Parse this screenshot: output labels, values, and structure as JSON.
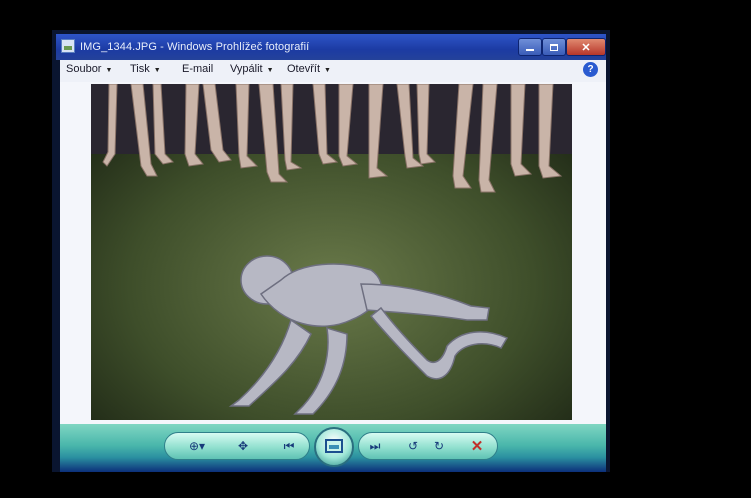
{
  "window": {
    "title": "IMG_1344.JPG - Windows Prohlížeč fotografií"
  },
  "menu": {
    "items": [
      {
        "label": "Soubor",
        "has_dropdown": true
      },
      {
        "label": "Tisk",
        "has_dropdown": true
      },
      {
        "label": "E-mail",
        "has_dropdown": false
      },
      {
        "label": "Vypálit",
        "has_dropdown": true
      },
      {
        "label": "Otevřít",
        "has_dropdown": true
      }
    ],
    "help_label": "?"
  },
  "photo": {
    "description_icon": "photo-image"
  },
  "toolbar": {
    "icons": [
      "zoom-icon",
      "actual-size-icon",
      "previous-icon",
      "slideshow-icon",
      "next-icon",
      "rotate-left-icon",
      "rotate-right-icon",
      "delete-icon"
    ]
  },
  "colors": {
    "titlebar": "#1c3ba3",
    "menubar": "#eef1f8",
    "toolbar": "#49b6ab",
    "close_button": "#b7362a"
  }
}
